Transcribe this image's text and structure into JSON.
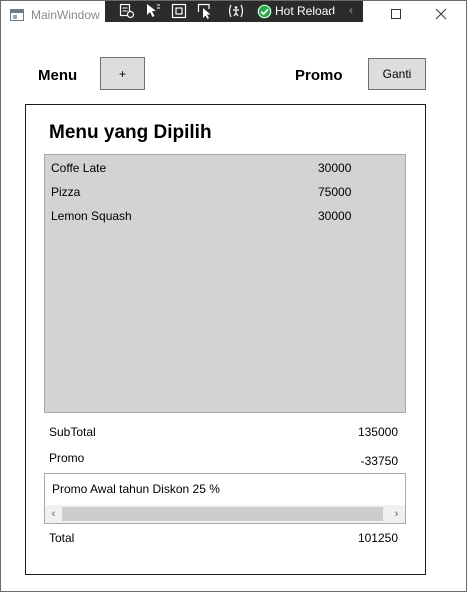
{
  "window": {
    "title": "MainWindow",
    "hot_reload_label": "Hot Reload",
    "collapse_glyph": "‹",
    "controls": [
      "minimize-icon",
      "maximize-icon",
      "close-icon"
    ]
  },
  "header": {
    "menu_label": "Menu",
    "add_button_label": "+",
    "promo_label": "Promo",
    "ganti_button_label": "Ganti"
  },
  "selected": {
    "title": "Menu yang Dipilih",
    "items": [
      {
        "name": "Coffe Late",
        "price": "30000"
      },
      {
        "name": "Pizza",
        "price": "75000"
      },
      {
        "name": "Lemon Squash",
        "price": "30000"
      }
    ]
  },
  "summary": {
    "subtotal_label": "SubTotal",
    "subtotal_value": "135000",
    "promo_label": "Promo",
    "promo_value": "-33750",
    "promo_description": "Promo Awal tahun Diskon 25 %",
    "total_label": "Total",
    "total_value": "101250"
  },
  "colors": {
    "list_background": "#d3d3d3",
    "button_background": "#dddddd",
    "toolbar_background": "#2b2b2b",
    "hot_reload_check": "#2aa84a"
  }
}
